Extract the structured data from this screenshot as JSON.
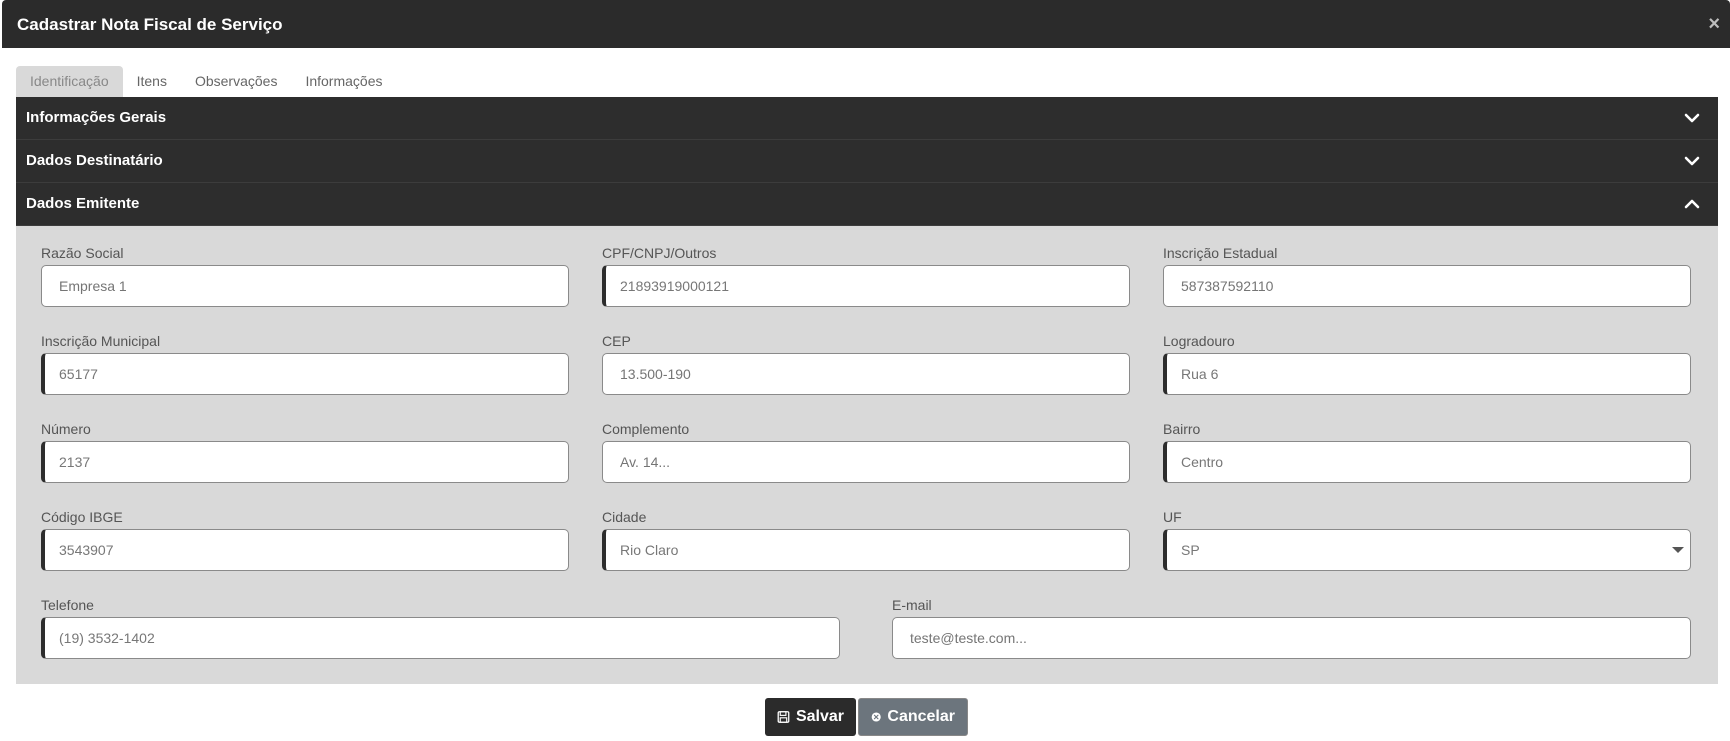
{
  "modal": {
    "title": "Cadastrar Nota Fiscal de Serviço",
    "close_label": "×"
  },
  "tabs": [
    {
      "label": "Identificação",
      "active": true
    },
    {
      "label": "Itens"
    },
    {
      "label": "Observações"
    },
    {
      "label": "Informações"
    }
  ],
  "sections": [
    {
      "title": "Informações Gerais",
      "expanded": false,
      "icon": "chevron-down-icon"
    },
    {
      "title": "Dados Destinatário",
      "expanded": false,
      "icon": "chevron-down-icon"
    },
    {
      "title": "Dados Emitente",
      "expanded": true,
      "icon": "chevron-up-icon"
    }
  ],
  "emitente": {
    "razao_social": {
      "label": "Razão Social",
      "placeholder": "Empresa 1"
    },
    "cpf_cnpj": {
      "label": "CPF/CNPJ/Outros",
      "value": "21893919000121"
    },
    "inscricao_estadual": {
      "label": "Inscrição Estadual",
      "placeholder": "587387592110"
    },
    "inscricao_municipal": {
      "label": "Inscrição Municipal",
      "value": "65177"
    },
    "cep": {
      "label": "CEP",
      "placeholder": "13.500-190"
    },
    "logradouro": {
      "label": "Logradouro",
      "value": "Rua 6"
    },
    "numero": {
      "label": "Número",
      "value": "2137"
    },
    "complemento": {
      "label": "Complemento",
      "placeholder": "Av. 14..."
    },
    "bairro": {
      "label": "Bairro",
      "value": "Centro"
    },
    "codigo_ibge": {
      "label": "Código IBGE",
      "value": "3543907"
    },
    "cidade": {
      "label": "Cidade",
      "value": "Rio Claro"
    },
    "uf": {
      "label": "UF",
      "value": "SP"
    },
    "telefone": {
      "label": "Telefone",
      "value": "(19) 3532-1402"
    },
    "email": {
      "label": "E-mail",
      "placeholder": "teste@teste.com..."
    }
  },
  "footer": {
    "save_label": "Salvar",
    "cancel_label": "Cancelar"
  }
}
